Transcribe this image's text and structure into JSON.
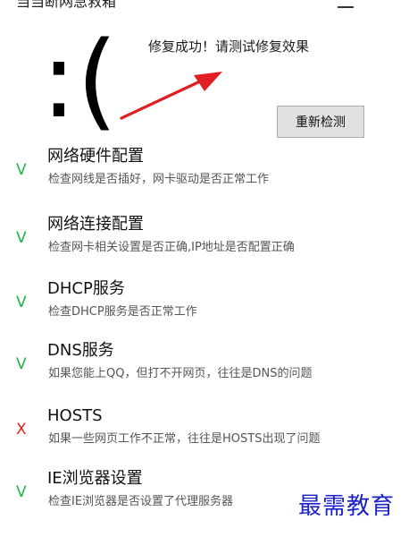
{
  "window": {
    "title": "当当断网急救箱"
  },
  "hero": {
    "face": ":(",
    "message": "修复成功！请测试修复效果",
    "recheck_label": "重新检测"
  },
  "items": [
    {
      "status": "V",
      "title": "网络硬件配置",
      "desc": "检查网线是否插好，网卡驱动是否正常工作"
    },
    {
      "status": "V",
      "title": "网络连接配置",
      "desc": "检查网卡相关设置是否正确,IP地址是否配置正确"
    },
    {
      "status": "V",
      "title": "DHCP服务",
      "desc": "检查DHCP服务是否正常工作"
    },
    {
      "status": "V",
      "title": "DNS服务",
      "desc": "如果您能上QQ，但打不开网页，往往是DNS的问题"
    },
    {
      "status": "X",
      "title": "HOSTS",
      "desc": "如果一些网页工作不正常，往往是HOSTS出现了问题"
    },
    {
      "status": "V",
      "title": "IE浏览器设置",
      "desc": "检查IE浏览器是否设置了代理服务器"
    }
  ],
  "watermark": "最需教育",
  "colors": {
    "ok": "#22b14c",
    "fail": "#e02020",
    "arrow": "#e01e25",
    "watermark": "#1b22c8"
  }
}
